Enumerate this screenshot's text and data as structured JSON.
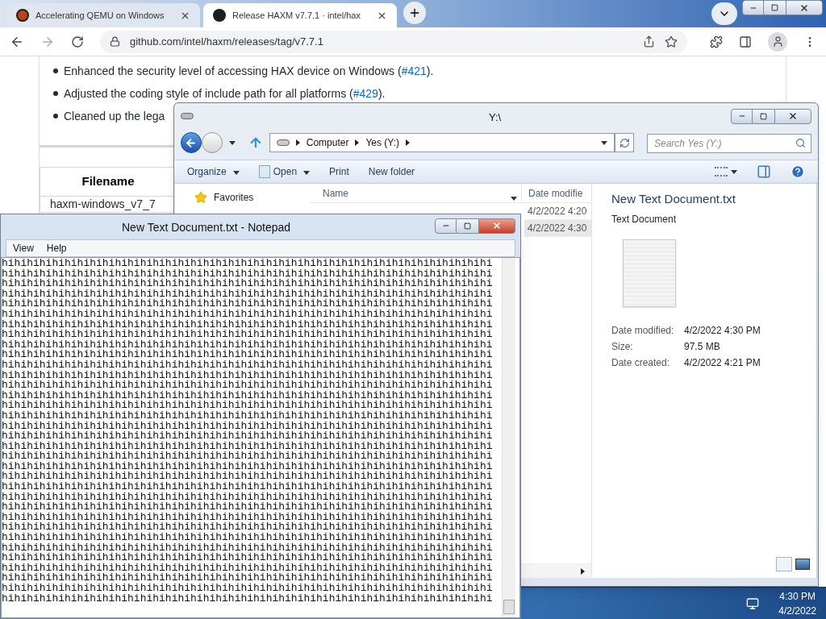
{
  "browser": {
    "tabs": [
      {
        "title": "Accelerating QEMU on Windows",
        "selected": false
      },
      {
        "title": "Release HAXM v7.7.1 · intel/hax",
        "selected": true
      }
    ],
    "url": "github.com/intel/haxm/releases/tag/v7.7.1",
    "bullets": [
      {
        "text": "Enhanced the security level of accessing HAX device on Windows (",
        "link": "#421",
        "after": ")."
      },
      {
        "text": "Adjusted the coding style of include path for all platforms (",
        "link": "#429",
        "after": ")."
      },
      {
        "text": "Cleaned up the lega"
      }
    ],
    "table": {
      "header": "Filename",
      "cell": "haxm-windows_v7_7"
    }
  },
  "explorer": {
    "title": "Y:\\",
    "breadcrumb": [
      "Computer",
      "Yes (Y:)"
    ],
    "search": {
      "placeholder": "Search Yes (Y:)"
    },
    "toolbar": [
      {
        "label": "Organize",
        "kind": "menu"
      },
      {
        "label": "Open",
        "kind": "menu-with-icon"
      },
      {
        "label": "Print",
        "kind": "plain"
      },
      {
        "label": "New folder",
        "kind": "plain"
      }
    ],
    "nav": [
      "Favorites"
    ],
    "columns": [
      "Name",
      "Date modifie"
    ],
    "rows": [
      {
        "date": "4/2/2022 4:20",
        "selected": false
      },
      {
        "date": "4/2/2022 4:30",
        "selected": true
      }
    ],
    "preview": {
      "title": "New Text Document.txt",
      "type": "Text Document",
      "properties": [
        {
          "label": "Date modified:",
          "value": "4/2/2022 4:30 PM"
        },
        {
          "label": "Size:",
          "value": "97.5 MB"
        },
        {
          "label": "Date created:",
          "value": "4/2/2022 4:21 PM"
        }
      ]
    }
  },
  "notepad": {
    "title": "New Text Document.txt - Notepad",
    "menu": [
      "View",
      "Help"
    ],
    "lines": [
      "hihihihihihihihihihihihihihihihihihihihihihihihihihihihihihihihihihihihihihihi",
      "hihihihihihihihihihihihihihihihihihihihihihihihihihihihihihihihihihihihihihihi",
      "hihihihihihihihihihihihihihihihihihihihihihihihihihihihihihihihihihihihihihihi",
      "hihihihihihihihihihihihihihihihihihihihihihihihihihihihihihihihihihihihihihihi",
      "hihihihihihihihihihihihihihihihihihihihihihihihihihihihihihihihihihihihihihihi",
      "hihihihihihihihihihihihihihihihihihihihihihihihihihihihihihihihihihihihihihihi",
      "hihihihihihihihihihihihihihihihihihihihihihihihihihihihihihihihihihihihihihihi",
      "hihihihihihihihihihihihihihihihihihihihihihihihihihihihihihihihihihihihihihihi",
      "hihihihihihihihihihihihihihihihihihihihihihihihihihihihihihihihihihihihihihihi",
      "hihihihihihihihihihihihihihihihihihihihihihihihihihihihihihihihihihihihihihihi",
      "hihihihihihihihihihihihihihihihihihihihihihihihihihihihihihihihihihihihihihihi",
      "hihihihihihihihihihihihihihihihihihihihihihihihihihihihihihihihihihihihihihihi",
      "hihihihihihihihihihihihihihihihihihihihihihihihihihihihihihihihihihihihihihihi",
      "hihihihihihihihihihihihihihihihihihihihihihihihihihihihihihihihihihihihihihihi",
      "hihihihihihihihihihihihihihihihihihihihihihihihihihihihihihihihihihihihihihihi",
      "hihihihihihihihihihihihihihihihihihihihihihihihihihihihihihihihihihihihihihihi",
      "hihihihihihihihihihihihihihihihihihihihihihihihihihihihihihihihihihihihihihihi",
      "hihihihihihihihihihihihihihihihihihihihihihihihihihihihihihihihihihihihihihihi",
      "hihihihihihihihihihihihihihihihihihihihihihihihihihihihihihihihihihihihihihihi",
      "hihihihihihihihihihihihihihihihihihihihihihihihihihihihihihihihihihihihihihihi",
      "hihihihihihihihihihihihihihihihihihihihihihihihihihihihihihihihihihihihihihihi",
      "hihihihihihihihihihihihihihihihihihihihihihihihihihihihihihihihihihihihihihihi",
      "hihihihihihihihihihihihihihihihihihihihihihihihihihihihihihihihihihihihihihihi",
      "hihihihihihihihihihihihihihihihihihihihihihihihihihihihihihihihihihihihihihihi",
      "hihihihihihihihihihihihihihihihihihihihihihihihihihihihihihihihihihihihihihihi",
      "hihihihihihihihihihihihihihihihihihihihihihihihihihihihihihihihihihihihihihihi",
      "hihihihihihihihihihihihihihihihihihihihihihihihihihihihihihihihihihihihihihihi",
      "hihihihihihihihihihihihihihihihihihihihihihihihihihihihihihihihihihihihihihihi",
      "hihihihihihihihihihihihihihihihihihihihihihihihihihihihihihihihihihihihihihihi",
      "hihihihihihihihihihihihihihihihihihihihihihihihihihihihihihihihihihihihihihihi",
      "hihihihihihihihihihihihihihihihihihihihihihihihihihihihihihihihihihihihihihihi",
      "hihihihihihihihihihihihihihihihihihihihihihihihihihihihihihihihihihihihihihihi",
      "hihihihihihihihihihihihihihihihihihihihihihihihihihihihihihihihihihihihihihihi",
      "hihihihihihihihihihihihihihihihihihihihihihihihihihihihihihihihihihihihihihihi"
    ]
  },
  "taskbar": {
    "time": "4:30 PM",
    "date": "4/2/2022"
  }
}
